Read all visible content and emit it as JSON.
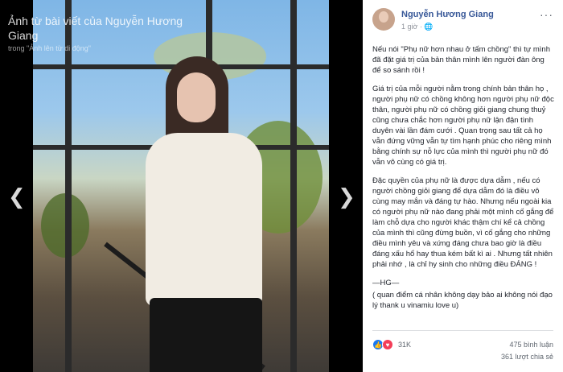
{
  "viewer": {
    "title": "Ảnh từ bài viết của Nguyễn Hương Giang",
    "subtitle": "trong \"Ảnh lên từ di động\"",
    "prev_icon": "chevron-left-icon",
    "next_icon": "chevron-right-icon"
  },
  "post": {
    "author": "Nguyễn Hương Giang",
    "time": "1 giờ",
    "privacy_icon": "globe-icon",
    "more_icon": "more-icon",
    "paragraphs": [
      "Nếu nói \"Phụ nữ hơn nhau ở tấm chồng\" thì tự mình đã đặt giá trị của bản thân mình lên người đàn ông để so sánh rồi !",
      "Giá trị của mỗi người nằm trong chính bản thân họ , người phụ nữ có chồng không hơn người phụ nữ độc thân, người phụ nữ có chồng giỏi giang chung thuỷ cũng chưa chắc hơn người phụ nữ lận đận tình duyên vài lần đám cưới . Quan trọng sau tất cả họ vẫn đứng vững vẫn tự tìm hạnh phúc cho riêng mình bằng chính sự nỗ lực của mình thì người phụ nữ đó vẫn vô cùng có giá trị.",
      "Đặc quyền của phụ nữ là được dựa dẫm , nếu có người chồng giỏi giang để dựa dẫm đó là điều vô cùng may mắn và đáng tự hào. Nhưng nếu ngoài kia có người phụ nữ nào đang phải một mình cố gắng để làm chỗ dựa cho người khác thậm chí kể cả chồng của mình thì cũng đừng buồn, vì cố gắng cho những điều mình yêu và xứng đáng chưa bao giờ là điều đáng xấu hổ hay thua kém bất kì ai . Nhưng tất nhiên phải nhớ , là chỉ hy sinh cho những điều ĐÁNG !",
      "—HG—",
      "( quan điểm cá nhân không dạy bảo ai không nói đạo lý thank u vinamiu love u)"
    ],
    "reactions_count": "31K",
    "comments": "475 bình luận",
    "shares": "361 lượt chia sẻ"
  }
}
